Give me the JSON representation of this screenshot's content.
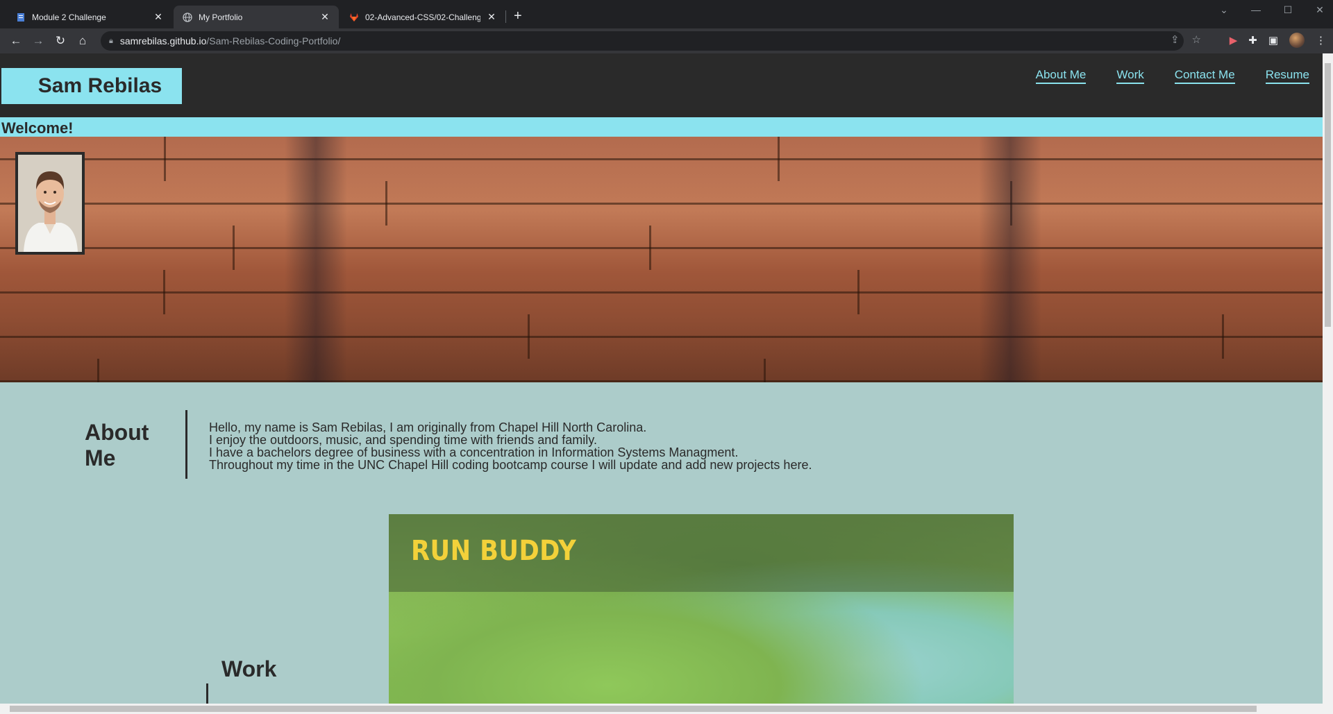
{
  "browser": {
    "tabs": [
      {
        "title": "Module 2 Challenge",
        "icon": "document-icon"
      },
      {
        "title": "My Portfolio",
        "icon": "globe-icon",
        "active": true
      },
      {
        "title": "02-Advanced-CSS/02-Challenge",
        "icon": "gitlab-icon"
      }
    ],
    "new_tab": "+",
    "url_host": "samrebilas.github.io",
    "url_path": "/Sam-Rebilas-Coding-Portfolio/"
  },
  "site": {
    "brand": "Sam Rebilas",
    "nav": [
      "About Me",
      "Work",
      "Contact Me",
      "Resume"
    ],
    "welcome": "Welcome!",
    "about": {
      "heading": "About Me",
      "lines": [
        "Hello, my name is Sam Rebilas, I am originally from Chapel Hill North Carolina.",
        "I enjoy the outdoors, music, and spending time with friends and family.",
        "I have a bachelors degree of business with a concentration in Information Systems Managment.",
        "Throughout my time in the UNC Chapel Hill coding bootcamp course I will update and add new projects here."
      ]
    },
    "work": {
      "heading": "Work",
      "project_title": "RUN BUDDY"
    }
  },
  "colors": {
    "accent": "#8be3ef",
    "header_bg": "#2a2a2a",
    "page_bg": "#acccca",
    "project_title": "#f3d13a"
  }
}
